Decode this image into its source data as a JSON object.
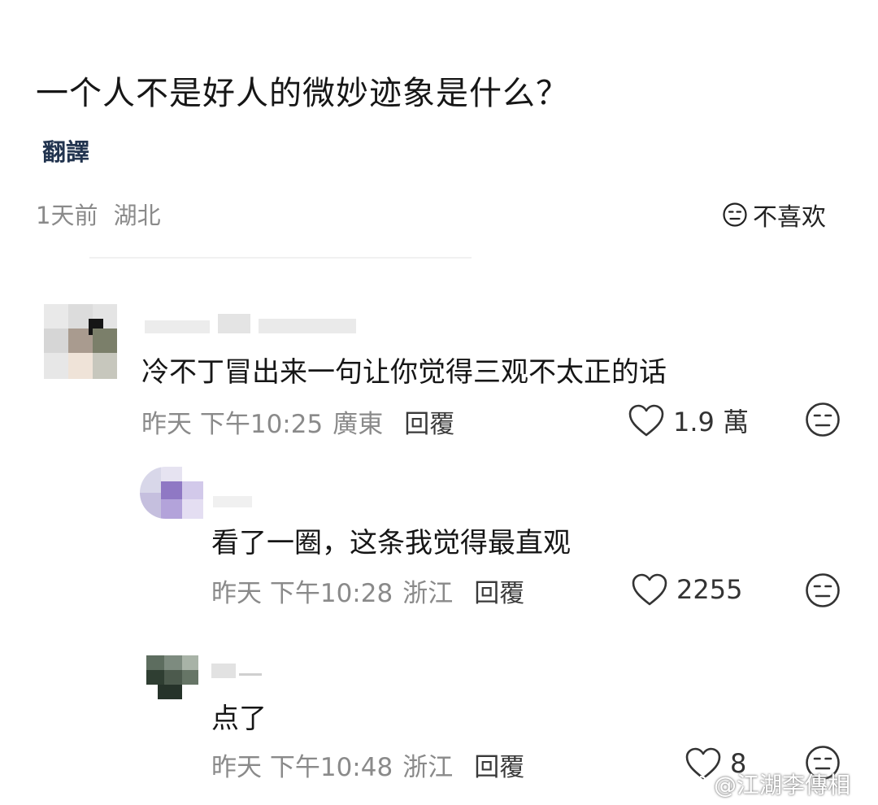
{
  "post": {
    "title": "一个人不是好人的微妙迹象是什么？",
    "translate_label": "翻譯",
    "time": "1天前",
    "location": "湖北",
    "dislike_label": "不喜欢"
  },
  "comments": [
    {
      "text": "冷不丁冒出来一句让你觉得三观不太正的话",
      "time": "昨天 下午10:25",
      "location": "廣東",
      "reply_label": "回覆",
      "likes": "1.9 萬"
    },
    {
      "text": "看了一圈，这条我觉得最直观",
      "time": "昨天 下午10:28",
      "location": "浙江",
      "reply_label": "回覆",
      "likes": "2255"
    },
    {
      "text": "点了",
      "time": "昨天 下午10:48",
      "location": "浙江",
      "reply_label": "回覆",
      "likes": "8"
    }
  ],
  "watermark": "@江湖李傳相",
  "icons": {
    "like": "heart-outline-icon",
    "dislike": "neutral-face-icon",
    "watermark": "weibo-logo-icon"
  }
}
